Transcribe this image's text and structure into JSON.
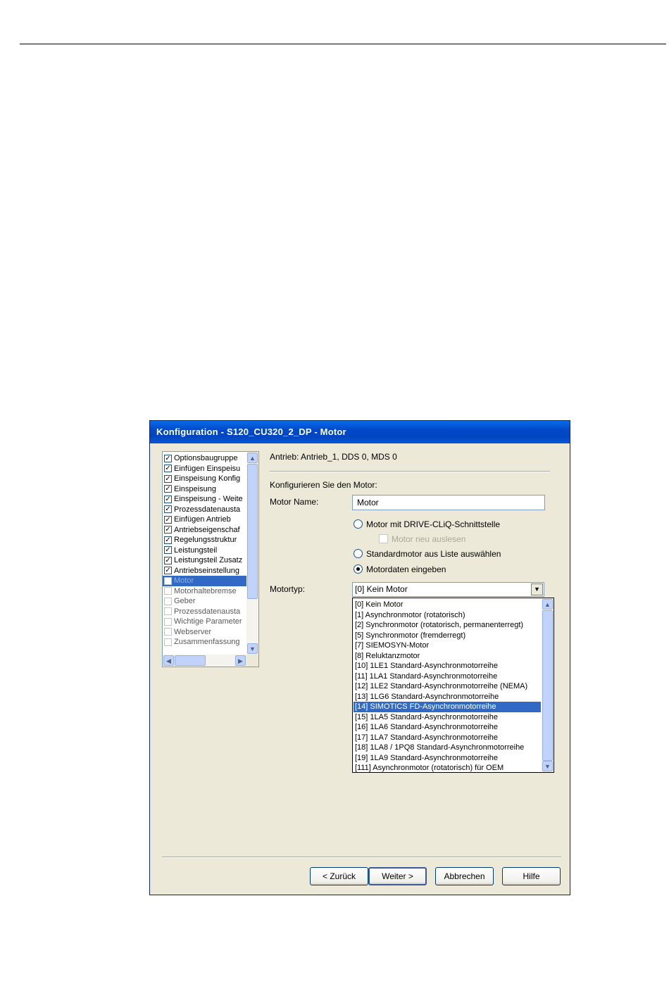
{
  "window": {
    "title": "Konfiguration - S120_CU320_2_DP - Motor"
  },
  "tree": {
    "items": [
      {
        "label": "Optionsbaugruppe",
        "checked": true
      },
      {
        "label": "Einfügen Einspeisu",
        "checked": true
      },
      {
        "label": "Einspeisung Konfig",
        "checked": true
      },
      {
        "label": "Einspeisung",
        "checked": true
      },
      {
        "label": "Einspeisung - Weite",
        "checked": true
      },
      {
        "label": "Prozessdatenausta",
        "checked": true
      },
      {
        "label": "Einfügen Antrieb",
        "checked": true
      },
      {
        "label": "Antriebseigenschaf",
        "checked": true
      },
      {
        "label": "Regelungsstruktur",
        "checked": true
      },
      {
        "label": "Leistungsteil",
        "checked": true
      },
      {
        "label": "Leistungsteil Zusatz",
        "checked": true
      },
      {
        "label": "Antriebseinstellung",
        "checked": true
      },
      {
        "label": "Motor",
        "checked": false,
        "selected": true
      },
      {
        "label": "Motorhaltebremse",
        "checked": false
      },
      {
        "label": "Geber",
        "checked": false
      },
      {
        "label": "Prozessdatenausta",
        "checked": false
      },
      {
        "label": "Wichtige Parameter",
        "checked": false
      },
      {
        "label": "Webserver",
        "checked": false
      },
      {
        "label": "Zusammenfassung",
        "checked": false
      }
    ]
  },
  "header": {
    "drive_info": "Antrieb: Antrieb_1, DDS 0, MDS 0"
  },
  "form": {
    "section_label": "Konfigurieren Sie den Motor:",
    "motor_name_label": "Motor Name:",
    "motor_name_value": "Motor",
    "radio_driveclick": "Motor mit DRIVE-CLiQ-Schnittstelle",
    "checkbox_read": "Motor neu auslesen",
    "radio_standard": "Standardmotor aus Liste auswählen",
    "radio_data": "Motordaten eingeben",
    "motortype_label": "Motortyp:",
    "motortype_selected": "[0] Kein Motor"
  },
  "dropdown": {
    "options": [
      "[0] Kein Motor",
      "[1] Asynchronmotor (rotatorisch)",
      "[2] Synchronmotor (rotatorisch, permanenterregt)",
      "[5] Synchronmotor (fremderregt)",
      "[7] SIEMOSYN-Motor",
      "[8] Reluktanzmotor",
      "[10] 1LE1 Standard-Asynchronmotorreihe",
      "[11] 1LA1 Standard-Asynchronmotorreihe",
      "[12] 1LE2 Standard-Asynchronmotorreihe (NEMA)",
      "[13] 1LG6 Standard-Asynchronmotorreihe",
      "[14] SIMOTICS FD-Asynchronmotorreihe",
      "[15] 1LA5 Standard-Asynchronmotorreihe",
      "[16] 1LA6 Standard-Asynchronmotorreihe",
      "[17] 1LA7 Standard-Asynchronmotorreihe",
      "[18] 1LA8 / 1PQ8 Standard-Asynchronmotorreihe",
      "[19] 1LA9 Standard-Asynchronmotorreihe",
      "[111] Asynchronmotor (rotatorisch) für OEM"
    ],
    "highlighted_index": 10
  },
  "buttons": {
    "back": "< Zurück",
    "next": "Weiter >",
    "cancel": "Abbrechen",
    "help": "Hilfe"
  },
  "colors": {
    "title_bar": "#0a5fdc",
    "selection": "#316ac5",
    "dialog_bg": "#ece9d8"
  }
}
